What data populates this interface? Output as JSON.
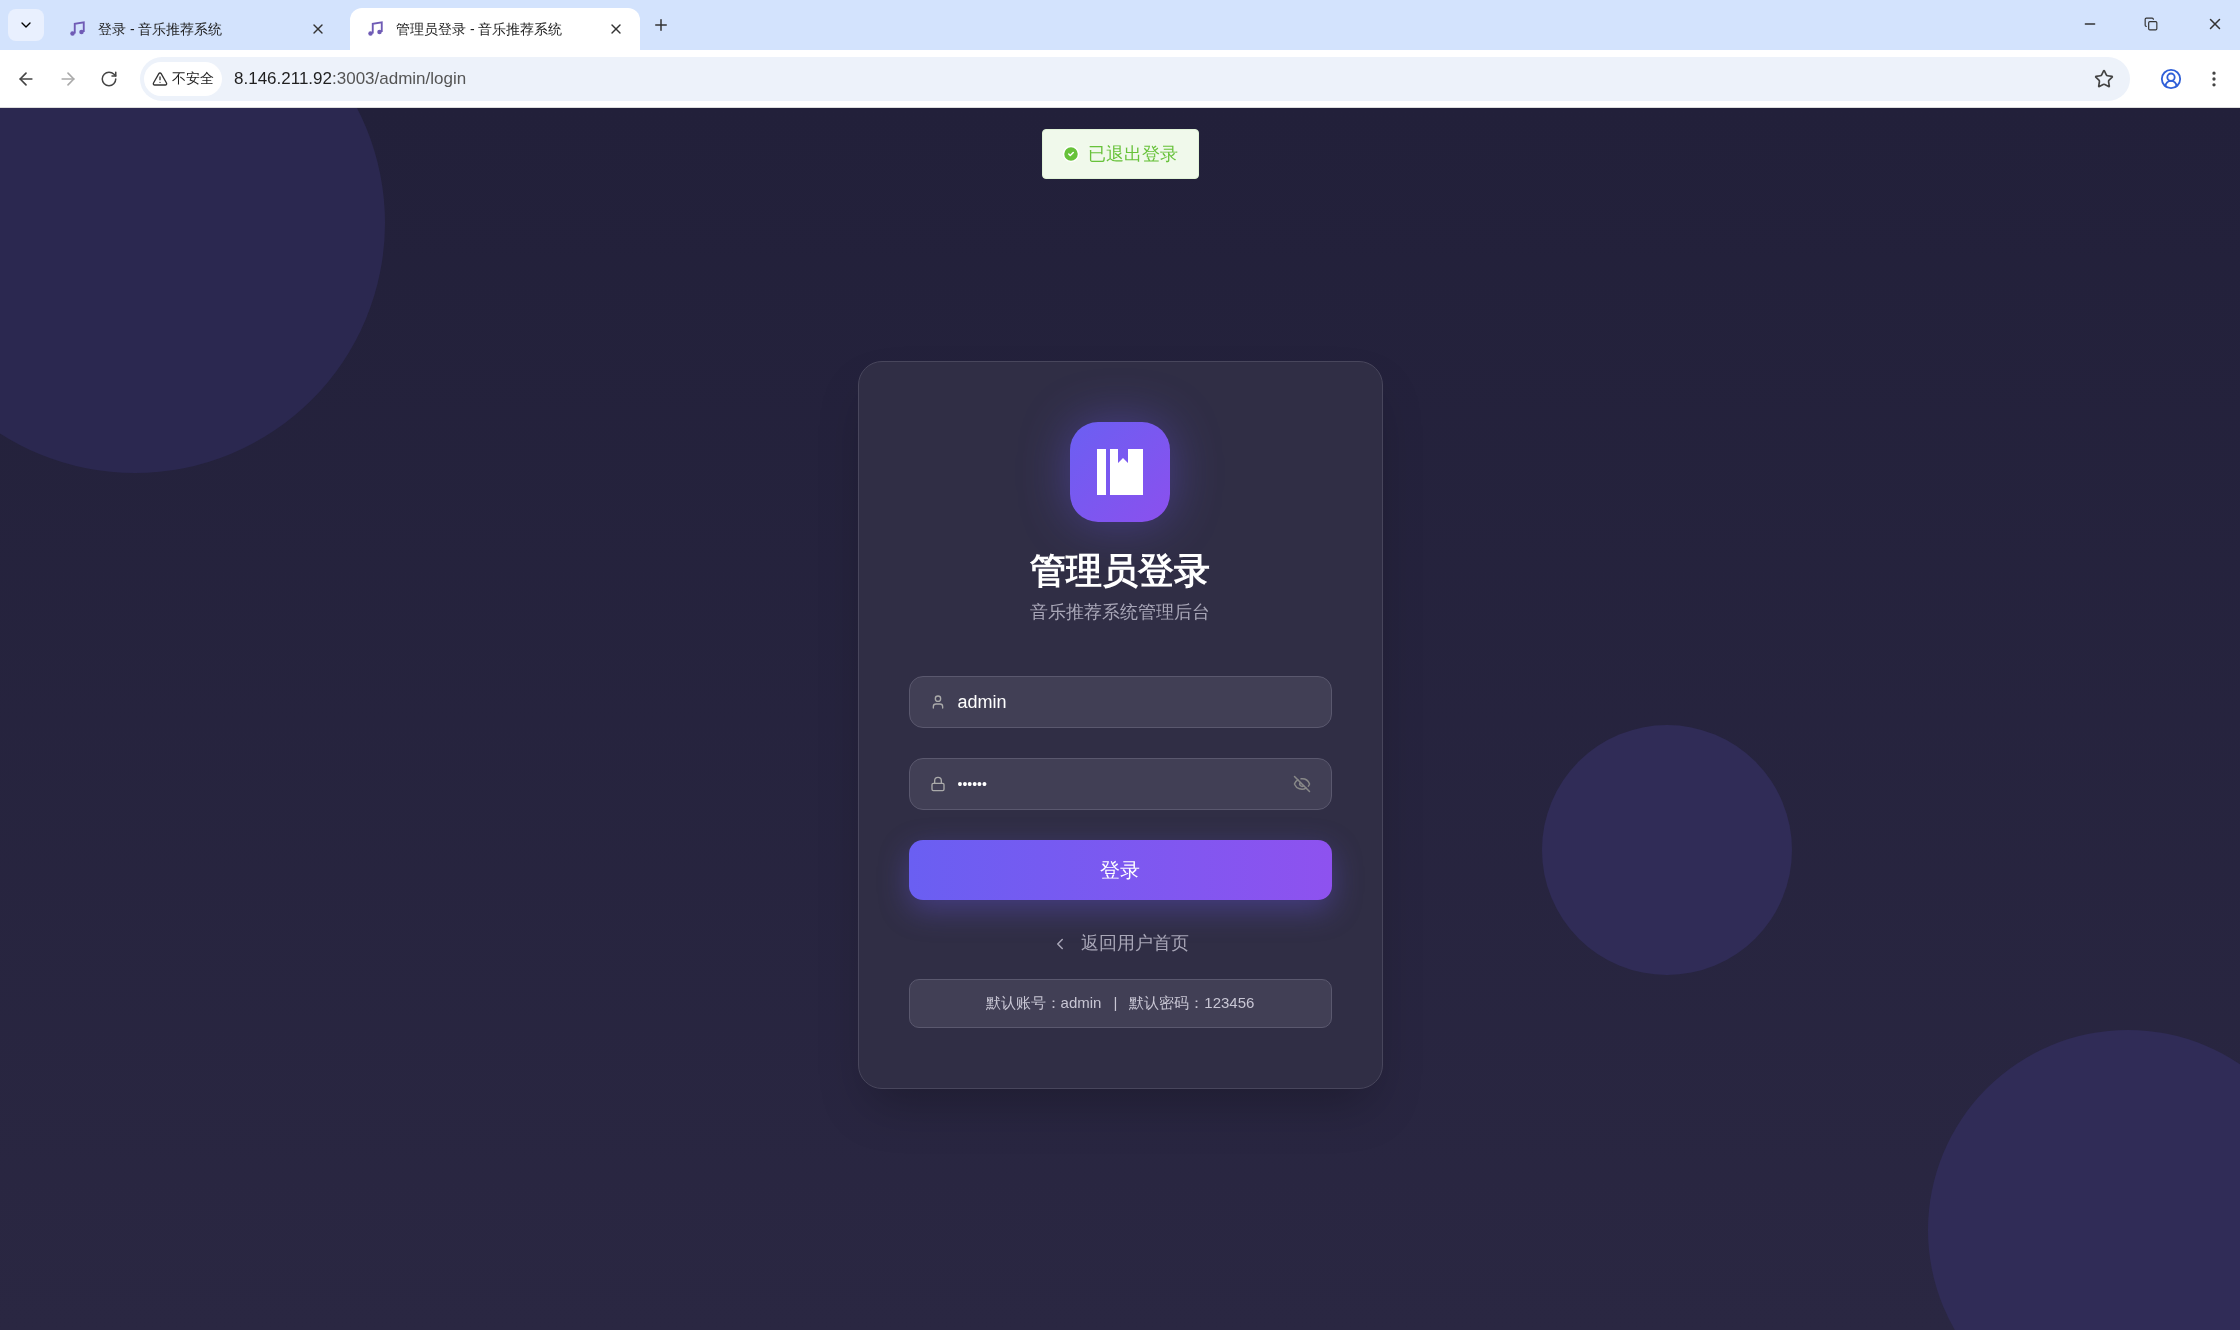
{
  "browser": {
    "tabs": [
      {
        "title": "登录 - 音乐推荐系统",
        "selected": false
      },
      {
        "title": "管理员登录 - 音乐推荐系统",
        "selected": true
      }
    ],
    "security_label": "不安全",
    "url_host": "8.146.211.92",
    "url_rest": ":3003/admin/login"
  },
  "toast": {
    "text": "已退出登录"
  },
  "login": {
    "title": "管理员登录",
    "subtitle": "音乐推荐系统管理后台",
    "username": {
      "value": "admin"
    },
    "password": {
      "value": "••••••"
    },
    "submit": "登录",
    "back_link": "返回用户首页",
    "hint": {
      "account_label": "默认账号：",
      "account": "admin",
      "separator": "|",
      "password_label": "默认密码：",
      "password": "123456"
    }
  }
}
